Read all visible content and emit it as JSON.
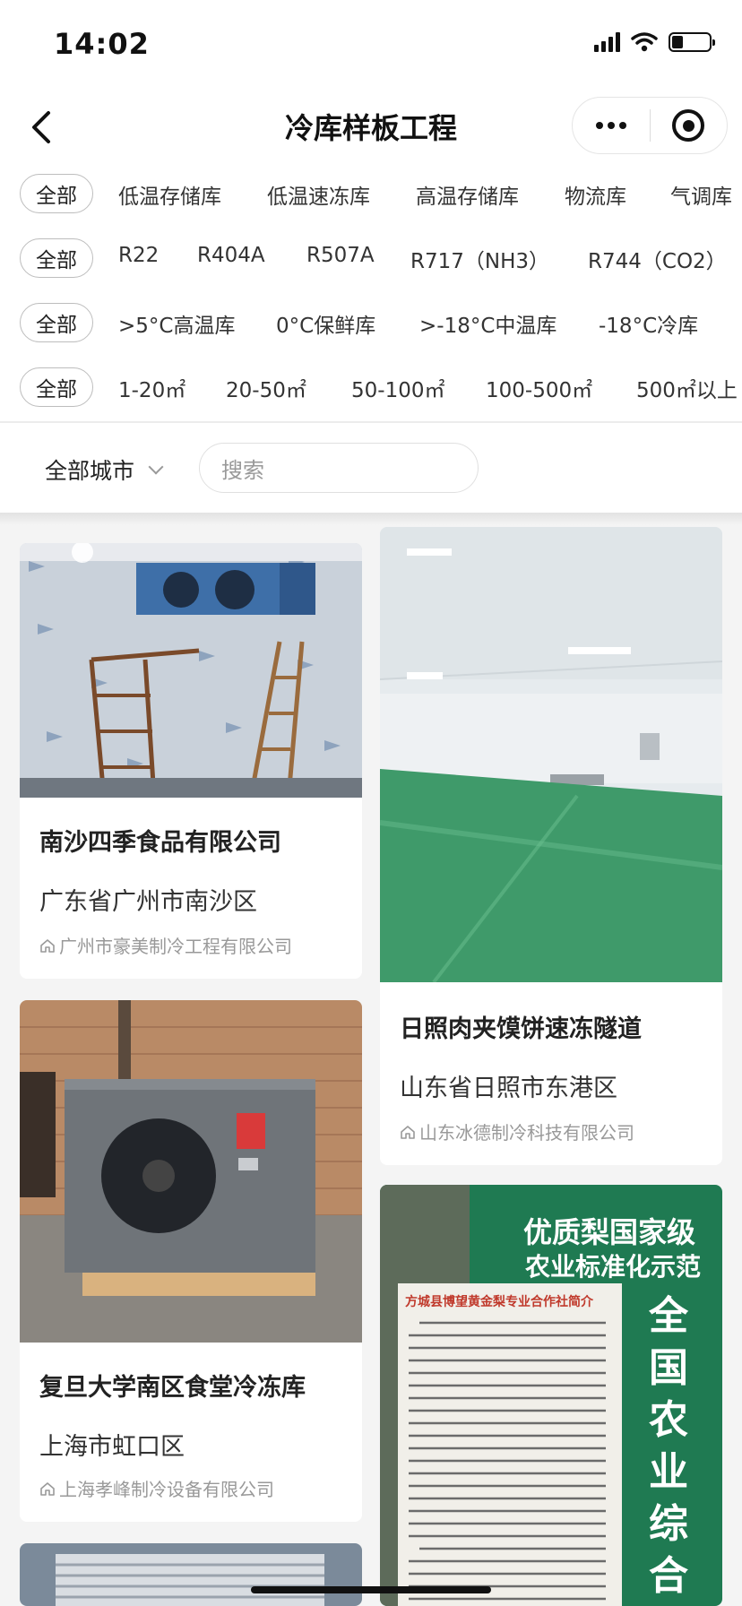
{
  "status_bar": {
    "time": "14:02"
  },
  "nav": {
    "title": "冷库样板工程"
  },
  "filters": [
    {
      "all": "全部",
      "options": [
        "低温存储库",
        "低温速冻库",
        "高温存储库",
        "物流库",
        "气调库"
      ]
    },
    {
      "all": "全部",
      "options": [
        "R22",
        "R404A",
        "R507A",
        "R717（NH3）",
        "R744（CO2）"
      ]
    },
    {
      "all": "全部",
      "options": [
        ">5°C高温库",
        "0°C保鲜库",
        ">-18°C中温库",
        "-18°C冷库"
      ]
    },
    {
      "all": "全部",
      "options": [
        "1-20㎡",
        "20-50㎡",
        "50-100㎡",
        "100-500㎡",
        "500㎡以上"
      ]
    }
  ],
  "search": {
    "city": "全部城市",
    "placeholder": "搜索"
  },
  "projects": [
    {
      "title": "南沙四季食品有限公司",
      "location": "广东省广州市南沙区",
      "company": "广州市豪美制冷工程有限公司"
    },
    {
      "title": "复旦大学南区食堂冷冻库",
      "location": "上海市虹口区",
      "company": "上海孝峰制冷设备有限公司"
    },
    {
      "title": "日照肉夹馍饼速冻隧道",
      "location": "山东省日照市东港区",
      "company": "山东冰德制冷科技有限公司"
    }
  ],
  "sign_photo": {
    "board_line1": "优质梨国家级",
    "board_line2": "农业标准化示范",
    "board_vertical": "全国农业综合",
    "notice_title": "方城县博望黄金梨专业合作社简介"
  },
  "colors": {
    "accent": "#222222",
    "muted": "#999999",
    "sign_green": "#1f7a52"
  }
}
